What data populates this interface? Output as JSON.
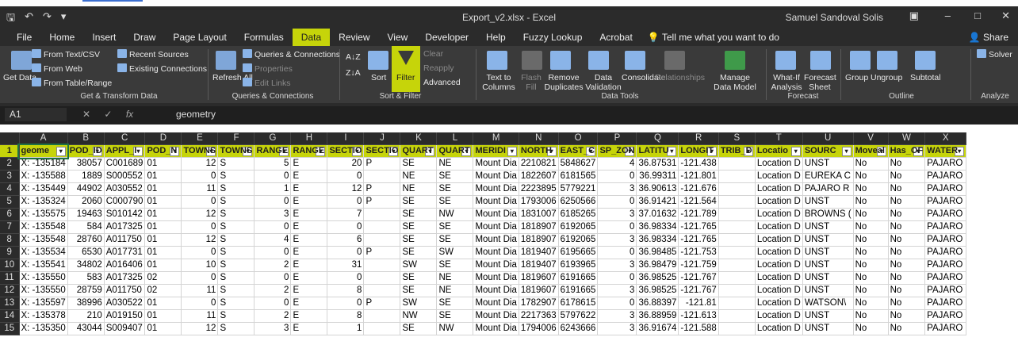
{
  "window": {
    "title": "Export_v2.xlsx - Excel",
    "user": "Samuel Sandoval Solis",
    "share": "Share"
  },
  "tabs": [
    "File",
    "Home",
    "Insert",
    "Draw",
    "Page Layout",
    "Formulas",
    "Data",
    "Review",
    "View",
    "Developer",
    "Help",
    "Fuzzy Lookup",
    "Acrobat"
  ],
  "active_tab": "Data",
  "tell_me": "Tell me what you want to do",
  "ribbon": {
    "get_transform": {
      "get_data": "Get Data",
      "from_text_csv": "From Text/CSV",
      "from_web": "From Web",
      "from_table_range": "From Table/Range",
      "recent_sources": "Recent Sources",
      "existing_connections": "Existing Connections",
      "label": "Get & Transform Data"
    },
    "queries": {
      "refresh_all": "Refresh All",
      "queries_connections": "Queries & Connections",
      "properties": "Properties",
      "edit_links": "Edit Links",
      "label": "Queries & Connections"
    },
    "sort_filter": {
      "sort": "Sort",
      "filter": "Filter",
      "clear": "Clear",
      "reapply": "Reapply",
      "advanced": "Advanced",
      "label": "Sort & Filter"
    },
    "data_tools": {
      "text_to_columns": "Text to Columns",
      "flash_fill": "Flash Fill",
      "remove_duplicates": "Remove Duplicates",
      "data_validation": "Data Validation",
      "consolidate": "Consolidate",
      "relationships": "Relationships",
      "manage_data_model": "Manage Data Model",
      "label": "Data Tools"
    },
    "forecast": {
      "what_if": "What-If Analysis",
      "forecast_sheet": "Forecast Sheet",
      "label": "Forecast"
    },
    "outline": {
      "group": "Group",
      "ungroup": "Ungroup",
      "subtotal": "Subtotal",
      "label": "Outline"
    },
    "analyze": {
      "solver": "Solver",
      "label": "Analyze"
    }
  },
  "formula_bar": {
    "name_box": "A1",
    "fx": "fx",
    "value": "geometry"
  },
  "sheet": {
    "columns": [
      "A",
      "B",
      "C",
      "D",
      "E",
      "F",
      "G",
      "H",
      "I",
      "J",
      "K",
      "L",
      "M",
      "N",
      "O",
      "P",
      "Q",
      "R",
      "S",
      "T",
      "U",
      "V",
      "W",
      "X"
    ],
    "headers": [
      "geome",
      "POD_ID",
      "APPL_I",
      "POD_N",
      "TOWNS",
      "TOWNS",
      "RANGE",
      "RANGE",
      "SECTIO",
      "SECTIO",
      "QUART",
      "QUART",
      "MERIDI",
      "NORTH",
      "EAST_C",
      "SP_ZON",
      "LATITU",
      "LONGIT",
      "TRIB_D",
      "Locatio",
      "SOURC",
      "Moveal",
      "Has_OF",
      "WATER"
    ],
    "rows": [
      [
        "X: -135184",
        "38057",
        "C001689",
        "01",
        "12",
        "S",
        "5",
        "E",
        "20",
        "P",
        "SE",
        "NE",
        "Mount Dia",
        "2210821",
        "5848627",
        "4",
        "36.87531",
        "-121.438",
        "",
        "Location D",
        "UNST",
        "No",
        "No",
        "PAJARO"
      ],
      [
        "X: -135588",
        "1889",
        "S000552",
        "01",
        "0",
        "S",
        "0",
        "E",
        "0",
        "",
        "NE",
        "SE",
        "Mount Dia",
        "1822607",
        "6181565",
        "0",
        "36.99311",
        "-121.801",
        "",
        "Location D",
        "EUREKA C",
        "No",
        "No",
        "PAJARO"
      ],
      [
        "X: -135449",
        "44902",
        "A030552",
        "01",
        "11",
        "S",
        "1",
        "E",
        "12",
        "P",
        "NE",
        "SE",
        "Mount Dia",
        "2223895",
        "5779221",
        "3",
        "36.90613",
        "-121.676",
        "",
        "Location D",
        "PAJARO R",
        "No",
        "No",
        "PAJARO"
      ],
      [
        "X: -135324",
        "2060",
        "C000790",
        "01",
        "0",
        "S",
        "0",
        "E",
        "0",
        "P",
        "SE",
        "SE",
        "Mount Dia",
        "1793006",
        "6250566",
        "0",
        "36.91421",
        "-121.564",
        "",
        "Location D",
        "UNST",
        "No",
        "No",
        "PAJARO"
      ],
      [
        "X: -135575",
        "19463",
        "S010142",
        "01",
        "12",
        "S",
        "3",
        "E",
        "7",
        "",
        "SE",
        "NW",
        "Mount Dia",
        "1831007",
        "6185265",
        "3",
        "37.01632",
        "-121.789",
        "",
        "Location D",
        "BROWNS (",
        "No",
        "No",
        "PAJARO"
      ],
      [
        "X: -135548",
        "584",
        "A017325",
        "01",
        "0",
        "S",
        "0",
        "E",
        "0",
        "",
        "SE",
        "SE",
        "Mount Dia",
        "1818907",
        "6192065",
        "0",
        "36.98334",
        "-121.765",
        "",
        "Location D",
        "UNST",
        "No",
        "No",
        "PAJARO"
      ],
      [
        "X: -135548",
        "28760",
        "A011750",
        "01",
        "12",
        "S",
        "4",
        "E",
        "6",
        "",
        "SE",
        "SE",
        "Mount Dia",
        "1818907",
        "6192065",
        "3",
        "36.98334",
        "-121.765",
        "",
        "Location D",
        "UNST",
        "No",
        "No",
        "PAJARO"
      ],
      [
        "X: -135534",
        "6530",
        "A017731",
        "01",
        "0",
        "S",
        "0",
        "E",
        "0",
        "P",
        "SE",
        "SW",
        "Mount Dia",
        "1819407",
        "6195665",
        "0",
        "36.98485",
        "-121.753",
        "",
        "Location D",
        "UNST",
        "No",
        "No",
        "PAJARO"
      ],
      [
        "X: -135541",
        "34802",
        "A016406",
        "01",
        "10",
        "S",
        "2",
        "E",
        "31",
        "",
        "SW",
        "SE",
        "Mount Dia",
        "1819407",
        "6193965",
        "3",
        "36.98479",
        "-121.759",
        "",
        "Location D",
        "UNST",
        "No",
        "No",
        "PAJARO"
      ],
      [
        "X: -135550",
        "583",
        "A017325",
        "02",
        "0",
        "S",
        "0",
        "E",
        "0",
        "",
        "SE",
        "NE",
        "Mount Dia",
        "1819607",
        "6191665",
        "0",
        "36.98525",
        "-121.767",
        "",
        "Location D",
        "UNST",
        "No",
        "No",
        "PAJARO"
      ],
      [
        "X: -135550",
        "28759",
        "A011750",
        "02",
        "11",
        "S",
        "2",
        "E",
        "8",
        "",
        "SE",
        "NE",
        "Mount Dia",
        "1819607",
        "6191665",
        "3",
        "36.98525",
        "-121.767",
        "",
        "Location D",
        "UNST",
        "No",
        "No",
        "PAJARO"
      ],
      [
        "X: -135597",
        "38996",
        "A030522",
        "01",
        "0",
        "S",
        "0",
        "E",
        "0",
        "P",
        "SW",
        "SE",
        "Mount Dia",
        "1782907",
        "6178615",
        "0",
        "36.88397",
        "-121.81",
        "",
        "Location D",
        "WATSON\\",
        "No",
        "No",
        "PAJARO"
      ],
      [
        "X: -135378",
        "210",
        "A019150",
        "01",
        "11",
        "S",
        "2",
        "E",
        "8",
        "",
        "NW",
        "SE",
        "Mount Dia",
        "2217363",
        "5797622",
        "3",
        "36.88959",
        "-121.613",
        "",
        "Location D",
        "UNST",
        "No",
        "No",
        "PAJARO"
      ],
      [
        "X: -135350",
        "43044",
        "S009407",
        "01",
        "12",
        "S",
        "3",
        "E",
        "1",
        "",
        "SE",
        "NW",
        "Mount Dia",
        "1794006",
        "6243666",
        "3",
        "36.91674",
        "-121.588",
        "",
        "Location D",
        "UNST",
        "No",
        "No",
        "PAJARO"
      ]
    ]
  }
}
